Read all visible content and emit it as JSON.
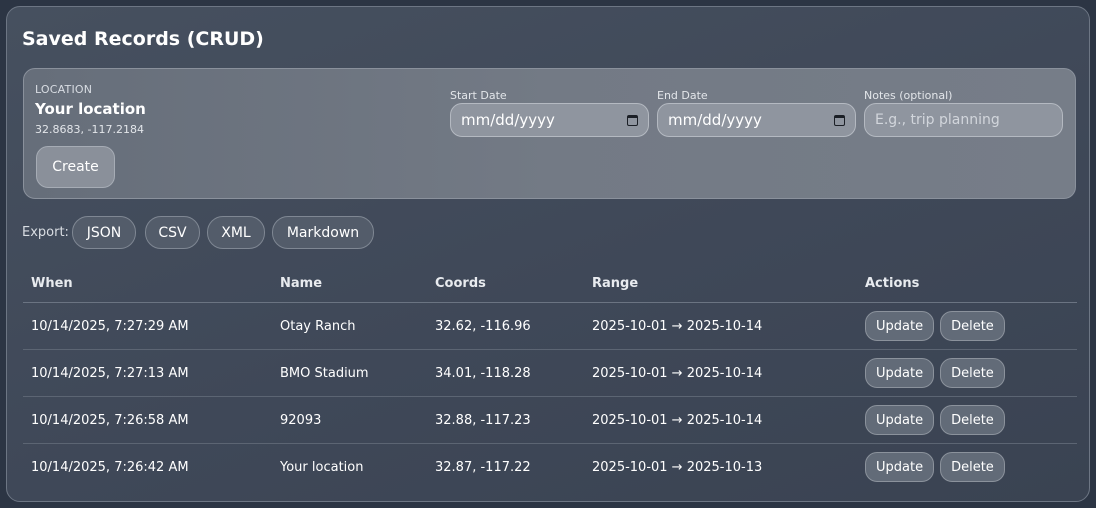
{
  "title": "Saved Records (CRUD)",
  "location": {
    "caption": "LOCATION",
    "name": "Your location",
    "coords": "32.8683, -117.2184",
    "create_label": "Create"
  },
  "form": {
    "start_date": {
      "label": "Start Date",
      "value": "mm/dd/yyyy"
    },
    "end_date": {
      "label": "End Date",
      "value": "mm/dd/yyyy"
    },
    "notes": {
      "label": "Notes (optional)",
      "placeholder": "E.g., trip planning"
    }
  },
  "export": {
    "label": "Export:",
    "buttons": [
      "JSON",
      "CSV",
      "XML",
      "Markdown"
    ]
  },
  "table": {
    "headers": [
      "When",
      "Name",
      "Coords",
      "Range",
      "Actions"
    ],
    "rows": [
      {
        "when": "10/14/2025, 7:27:29 AM",
        "name": "Otay Ranch",
        "coords": "32.62, -116.96",
        "range": "2025-10-01 → 2025-10-14"
      },
      {
        "when": "10/14/2025, 7:27:13 AM",
        "name": "BMO Stadium",
        "coords": "34.01, -118.28",
        "range": "2025-10-01 → 2025-10-14"
      },
      {
        "when": "10/14/2025, 7:26:58 AM",
        "name": "92093",
        "coords": "32.88, -117.23",
        "range": "2025-10-01 → 2025-10-14"
      },
      {
        "when": "10/14/2025, 7:26:42 AM",
        "name": "Your location",
        "coords": "32.87, -117.22",
        "range": "2025-10-01 → 2025-10-13"
      }
    ],
    "update_label": "Update",
    "delete_label": "Delete"
  }
}
